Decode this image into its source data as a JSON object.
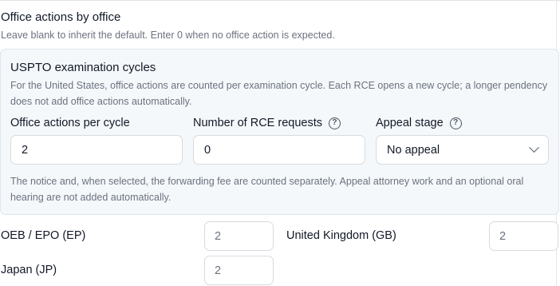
{
  "section": {
    "title": "Office actions by office",
    "hint": "Leave blank to inherit the default. Enter 0 when no office action is expected."
  },
  "uspto": {
    "title": "USPTO examination cycles",
    "description": "For the United States, office actions are counted per examination cycle. Each RCE opens a new cycle; a longer pendency does not add office actions automatically.",
    "fields": {
      "actions_per_cycle": {
        "label": "Office actions per cycle",
        "value": "2"
      },
      "rce_requests": {
        "label": "Number of RCE requests",
        "value": "0"
      },
      "appeal_stage": {
        "label": "Appeal stage",
        "selected": "No appeal"
      }
    },
    "note": "The notice and, when selected, the forwarding fee are counted separately. Appeal attorney work and an optional oral hearing are not added automatically."
  },
  "offices": [
    {
      "label": "OEB / EPO (EP)",
      "value": "2"
    },
    {
      "label": "United Kingdom (GB)",
      "value": "2"
    },
    {
      "label": "Japan (JP)",
      "value": "2"
    }
  ],
  "icons": {
    "help": "question-circle-icon",
    "dropdown": "chevron-down-icon"
  },
  "help_glyph": "?"
}
